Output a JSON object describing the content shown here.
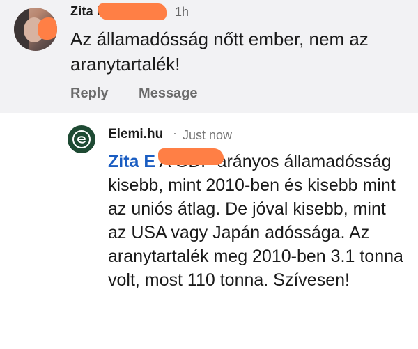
{
  "parent_comment": {
    "author_name": "Zita E",
    "time": "1h",
    "text": "Az államadósság nőtt ember, nem az aranytartalék!",
    "actions": {
      "reply_label": "Reply",
      "message_label": "Message"
    }
  },
  "reply_comment": {
    "author_name": "Elemi.hu",
    "separator": "·",
    "time": "Just now",
    "mention": "Zita E",
    "text": "A GDP arányos államadósság kisebb, mint 2010-ben és kisebb mint az uniós átlag. De jóval kisebb, mint az USA vagy Japán adóssága. Az aranytartalék meg 2010-ben 3.1 tonna volt, most 110 tonna. Szívesen!"
  },
  "colors": {
    "parent_background": "#f2f2f4",
    "mention_color": "#1a5dc2",
    "redaction_color": "#ff7f45",
    "page_avatar_color": "#1e4a33"
  }
}
